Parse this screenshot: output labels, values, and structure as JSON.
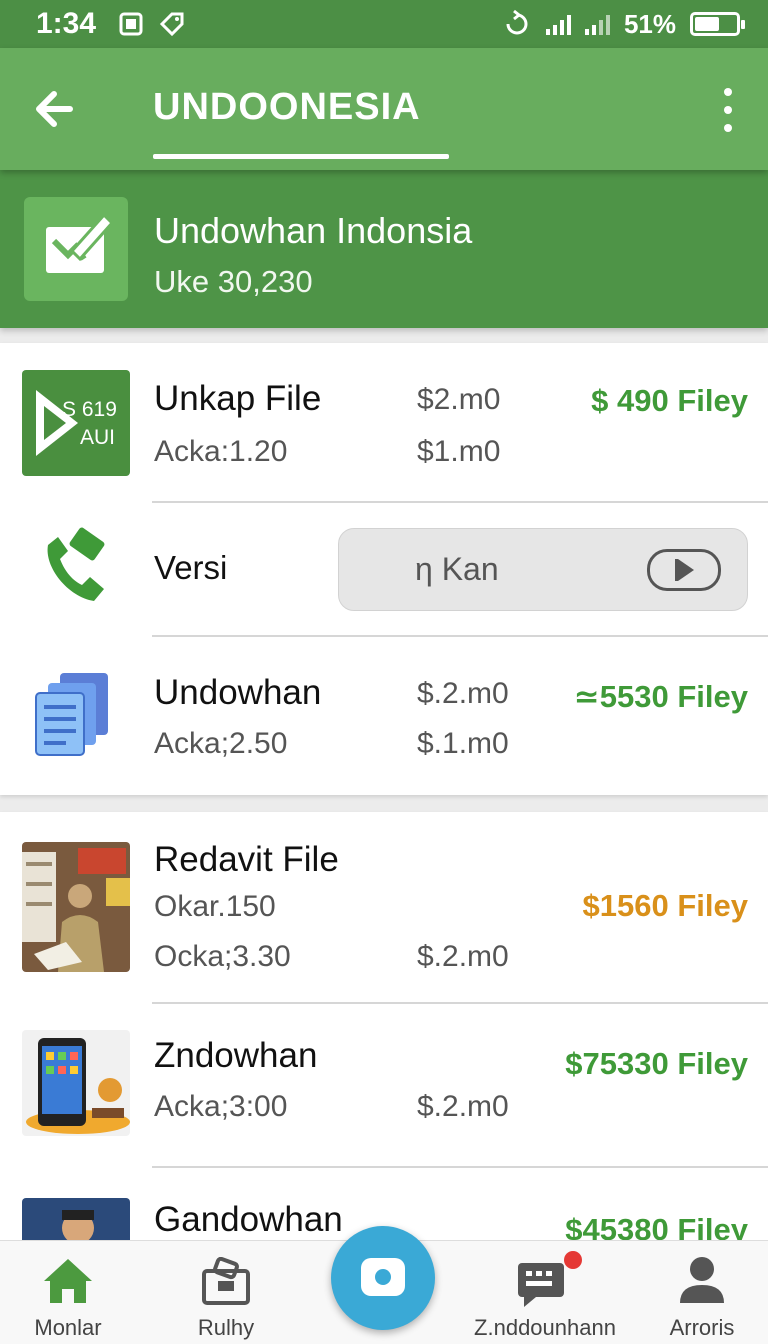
{
  "status_bar": {
    "time": "1:34",
    "battery": "51%"
  },
  "app_bar": {
    "title": "UNDOONESIA",
    "icons": {
      "back": "arrow-left-icon",
      "more": "more-vert-icon"
    }
  },
  "header": {
    "title": "Undowhan Indonsia",
    "subtitle": "Uke 30,230",
    "icon": "edit-check-icon"
  },
  "colors": {
    "primary": "#68ad5e",
    "primary_dark": "#4c8f45",
    "amount_green": "#3f9a38",
    "amount_orange": "#d9901a",
    "fab": "#3aa9d6"
  },
  "files": [
    {
      "name": "Unkap File",
      "thumb_text": [
        "S 619",
        "AUI"
      ],
      "sub": "Acka:1.20",
      "price1": "$2.m0",
      "price2": "$1.m0",
      "amount": "$ 490 Filey"
    },
    {
      "name": "Undowhan",
      "sub": "Acka;2.50",
      "price1": "$.2.m0",
      "price2": "$.1.m0",
      "amount": "≃5530 Filey"
    },
    {
      "name": "Redavit File",
      "sub": "Okar.150",
      "sub2": "Ocka;3.30",
      "price2": "$.2.m0",
      "amount": "$1560 Filey"
    },
    {
      "name": "Zndowhan",
      "sub": "Acka;3:00",
      "price2": "$.2.m0",
      "amount": "$75330 Filey"
    },
    {
      "name": "Gandowhan",
      "amount": "$45380 Filey"
    }
  ],
  "version_row": {
    "label": "Versi",
    "button_label": "η Kan",
    "icon": "phone-icon"
  },
  "bottom_nav": [
    {
      "label": "Monlar",
      "icon": "home-icon"
    },
    {
      "label": "Rulhy",
      "icon": "bag-icon"
    },
    {
      "label": "",
      "icon": "camera-icon"
    },
    {
      "label": "Z.nddounhann",
      "icon": "chat-icon"
    },
    {
      "label": "Arroris",
      "icon": "person-icon"
    }
  ]
}
